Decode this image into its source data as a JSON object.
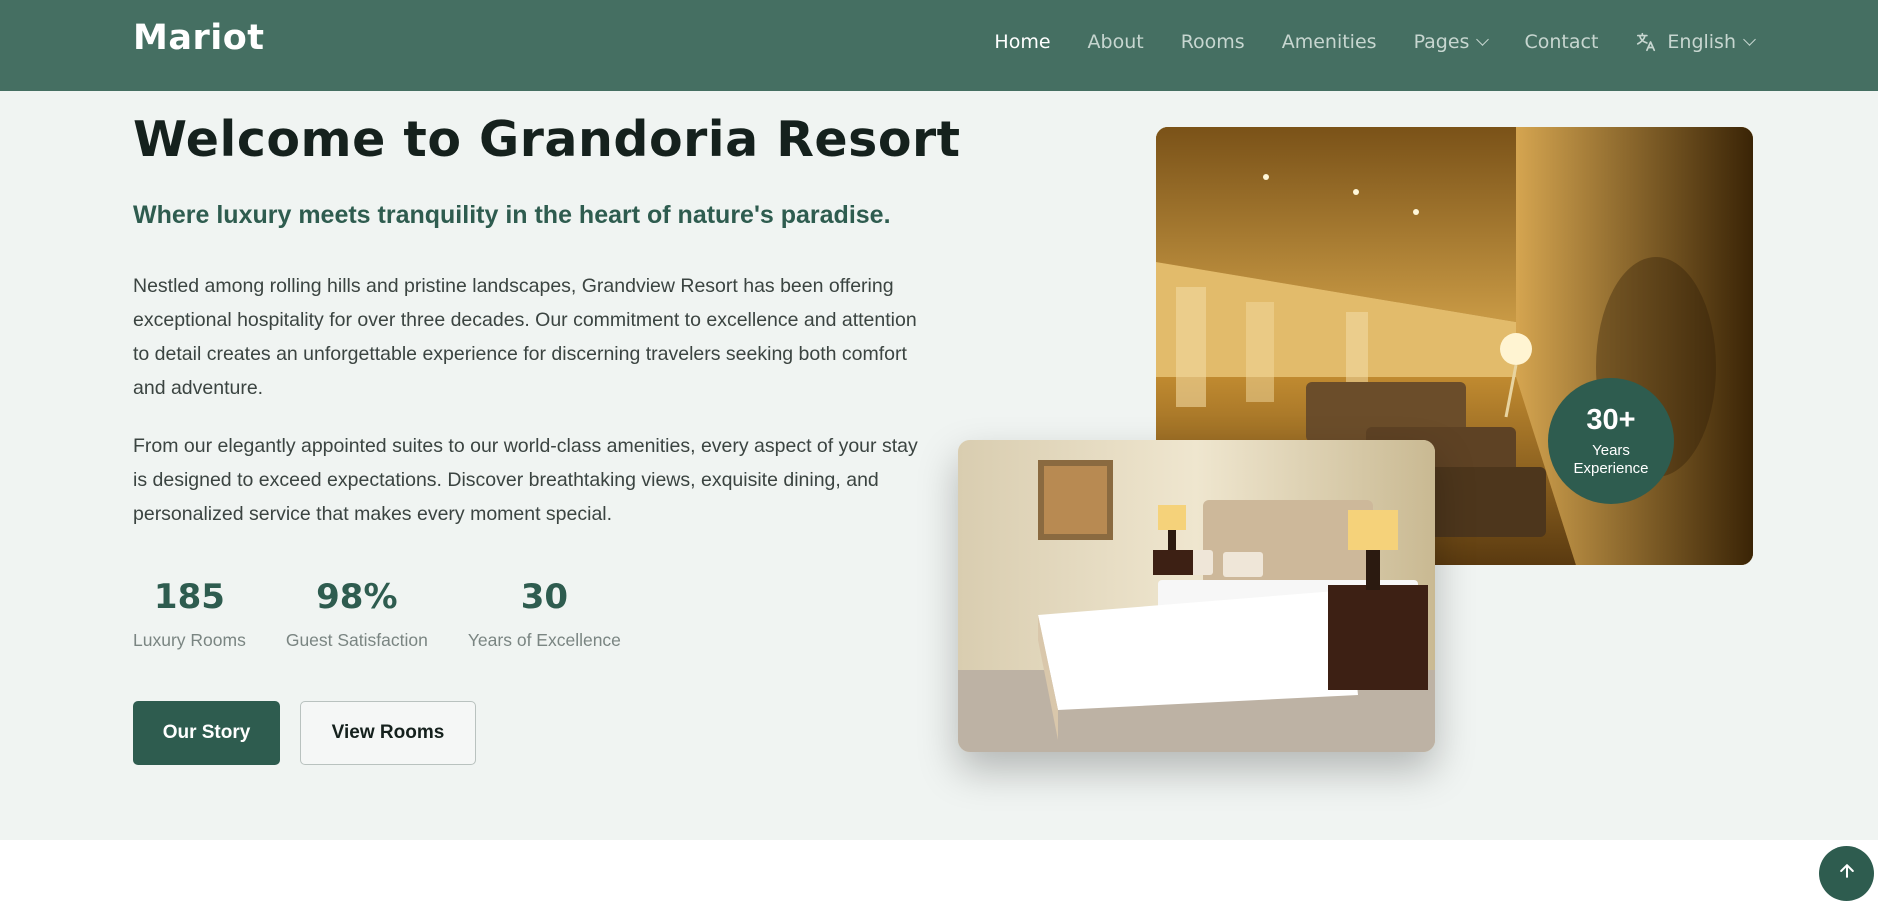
{
  "brand": {
    "logo": "Mariot"
  },
  "nav": {
    "items": [
      {
        "label": "Home",
        "active": true
      },
      {
        "label": "About"
      },
      {
        "label": "Rooms"
      },
      {
        "label": "Amenities"
      },
      {
        "label": "Pages",
        "dropdown": true
      },
      {
        "label": "Contact"
      }
    ],
    "language": {
      "label": "English",
      "icon": "translate-icon"
    }
  },
  "hero": {
    "title": "Welcome to Grandoria Resort",
    "subtitle": "Where luxury meets tranquility in the heart of nature's paradise.",
    "paragraphs": [
      "Nestled among rolling hills and pristine landscapes, Grandview Resort has been offering exceptional hospitality for over three decades. Our commitment to excellence and attention to detail creates an unforgettable experience for discerning travelers seeking both comfort and adventure.",
      "From our elegantly appointed suites to our world-class amenities, every aspect of your stay is designed to exceed expectations. Discover breathtaking views, exquisite dining, and personalized service that makes every moment special."
    ],
    "stats": [
      {
        "value": "185",
        "label": "Luxury Rooms"
      },
      {
        "value": "98%",
        "label": "Guest Satisfaction"
      },
      {
        "value": "30",
        "label": "Years of Excellence"
      }
    ],
    "buttons": {
      "primary": "Our Story",
      "secondary": "View Rooms"
    },
    "badge": {
      "value": "30+",
      "line1": "Years",
      "line2": "Experience"
    }
  },
  "colors": {
    "nav_bg": "#456f62",
    "accent": "#2e5c4f",
    "hero_bg": "#f0f4f2"
  },
  "icons": {
    "scroll_top": "arrow-up-icon",
    "language": "translate-icon",
    "dropdown": "chevron-down-icon"
  }
}
